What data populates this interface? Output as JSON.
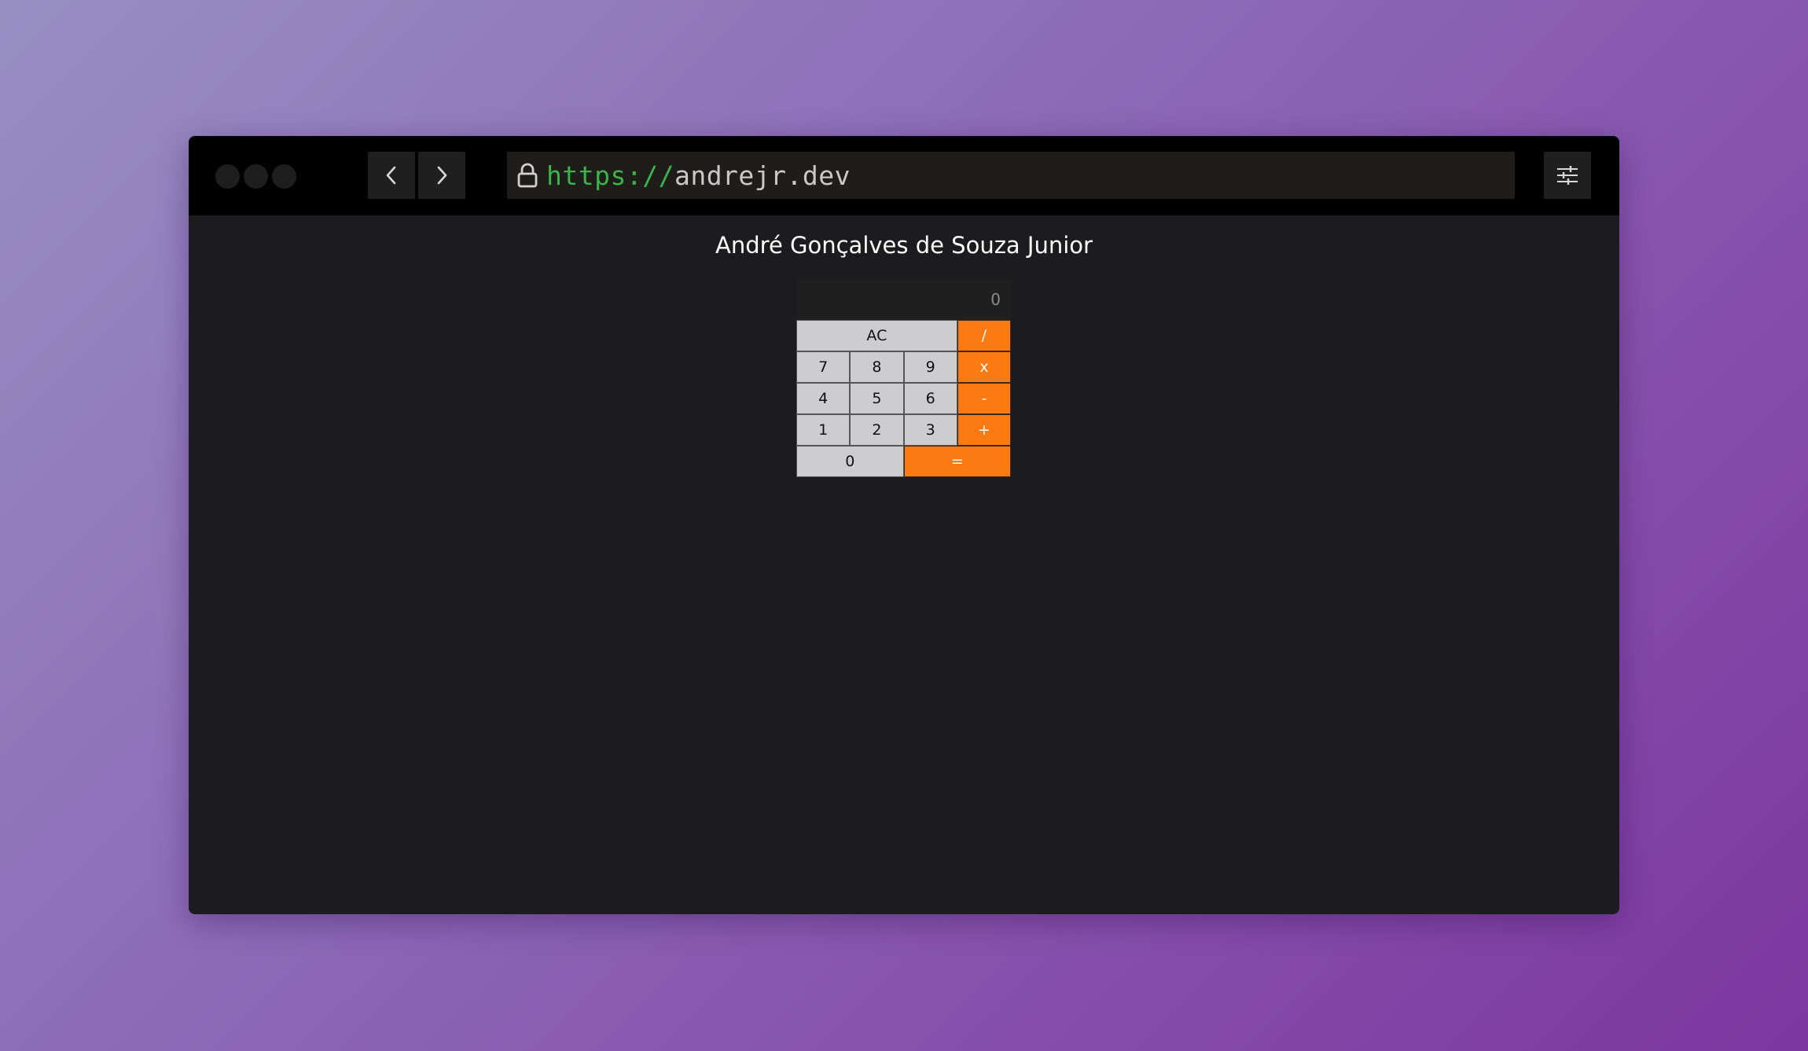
{
  "browser": {
    "url_scheme": "https://",
    "url_host": "andrejr.dev"
  },
  "page": {
    "title": "André Gonçalves de Souza Junior"
  },
  "calculator": {
    "display": "0",
    "keys": {
      "clear": "AC",
      "divide": "/",
      "seven": "7",
      "eight": "8",
      "nine": "9",
      "multiply": "x",
      "four": "4",
      "five": "5",
      "six": "6",
      "subtract": "-",
      "one": "1",
      "two": "2",
      "three": "3",
      "add": "+",
      "zero": "0",
      "equals": "="
    }
  },
  "colors": {
    "operator_key": "#fb7b12",
    "digit_key": "#cdcdcf",
    "url_scheme": "#3bb24a"
  }
}
